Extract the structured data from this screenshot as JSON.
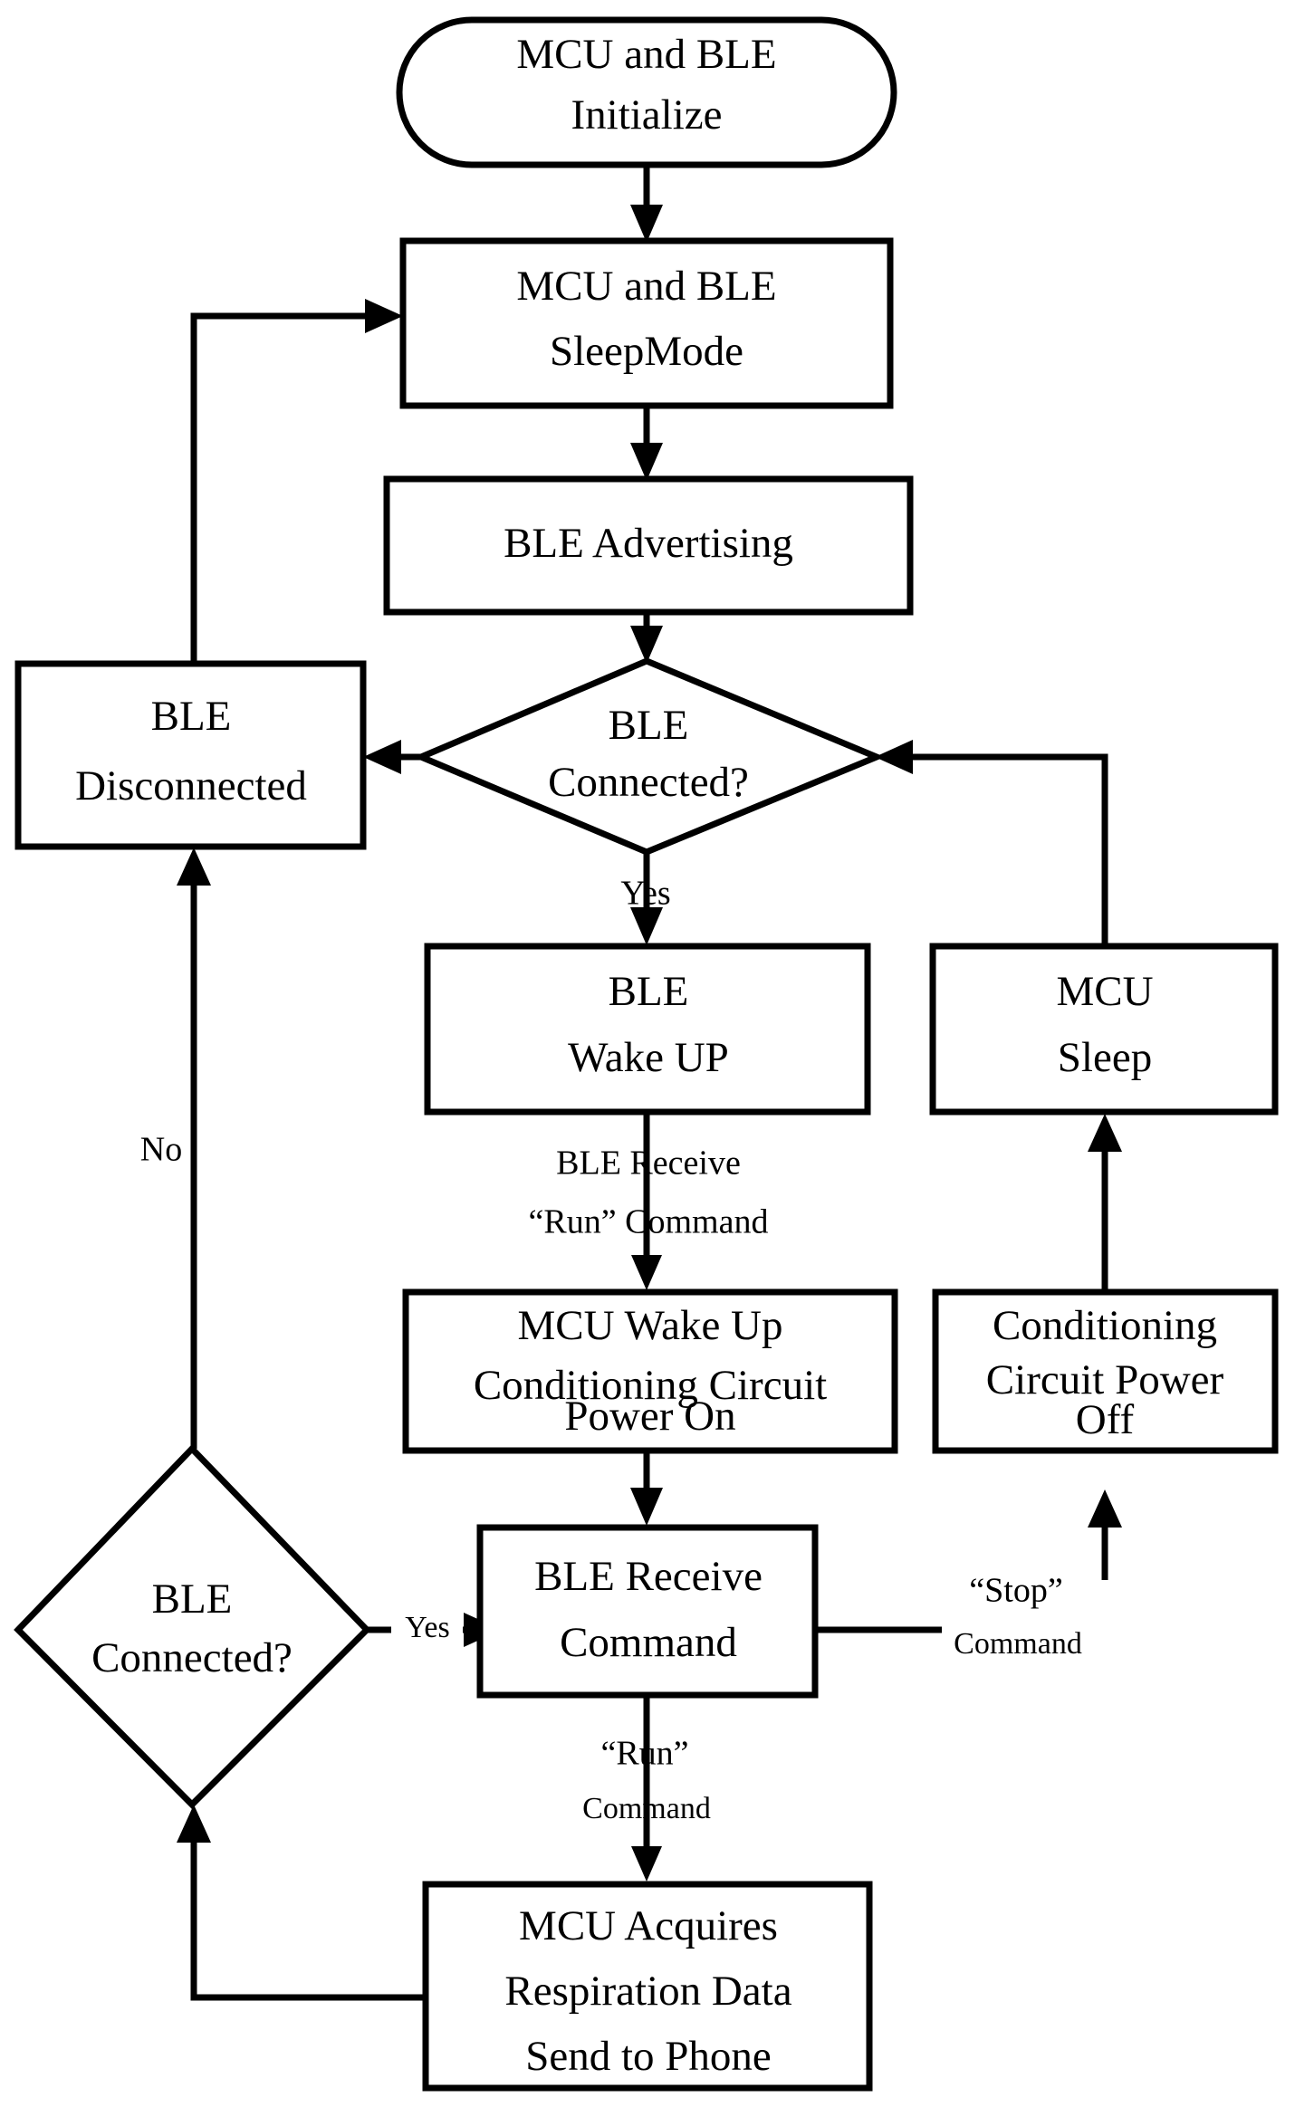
{
  "diagram": {
    "title": "MCU and BLE Firmware Flowchart",
    "type": "flowchart",
    "line_color": "#000000",
    "fill_color": "#ffffff",
    "nodes": [
      {
        "id": "start",
        "shape": "rounded-rectangle",
        "lines": [
          "MCU and BLE",
          "Initialize"
        ]
      },
      {
        "id": "sleep_mode",
        "shape": "rectangle",
        "lines": [
          "MCU and BLE",
          "SleepMode"
        ]
      },
      {
        "id": "advertising",
        "shape": "rectangle",
        "lines": [
          "BLE Advertising"
        ]
      },
      {
        "id": "connected_q1",
        "shape": "diamond",
        "lines": [
          "BLE",
          "Connected?"
        ]
      },
      {
        "id": "disconnected",
        "shape": "rectangle",
        "lines": [
          "BLE",
          "Disconnected"
        ]
      },
      {
        "id": "ble_wake_up",
        "shape": "rectangle",
        "lines": [
          "BLE",
          "Wake UP"
        ]
      },
      {
        "id": "mcu_sleep",
        "shape": "rectangle",
        "lines": [
          "MCU",
          "Sleep"
        ]
      },
      {
        "id": "mcu_wake_up",
        "shape": "rectangle",
        "lines": [
          "MCU Wake Up",
          "Conditioning Circuit",
          "Power On"
        ]
      },
      {
        "id": "circuit_power_off",
        "shape": "rectangle",
        "lines": [
          "Conditioning",
          "Circuit Power",
          "Off"
        ]
      },
      {
        "id": "connected_q2",
        "shape": "diamond",
        "lines": [
          "BLE",
          "Connected?"
        ]
      },
      {
        "id": "ble_receive_command",
        "shape": "rectangle",
        "lines": [
          "BLE Receive",
          "Command"
        ]
      },
      {
        "id": "acquire_data",
        "shape": "rectangle",
        "lines": [
          "MCU Acquires",
          "Respiration Data",
          "Send to Phone"
        ]
      }
    ],
    "edge_labels": [
      {
        "id": "yes_top",
        "text": "Yes"
      },
      {
        "id": "no_left",
        "text": "No"
      },
      {
        "id": "ble_receive_run_l1",
        "text": "BLE Receive"
      },
      {
        "id": "ble_receive_run_l2",
        "text": "“Run”  Command"
      },
      {
        "id": "stop_l1",
        "text": "“Stop”"
      },
      {
        "id": "stop_l2",
        "text": "Command"
      },
      {
        "id": "run_l1",
        "text": "“Run”"
      },
      {
        "id": "run_l2",
        "text": "Command"
      },
      {
        "id": "yes_bottom",
        "text": "Yes"
      }
    ]
  }
}
